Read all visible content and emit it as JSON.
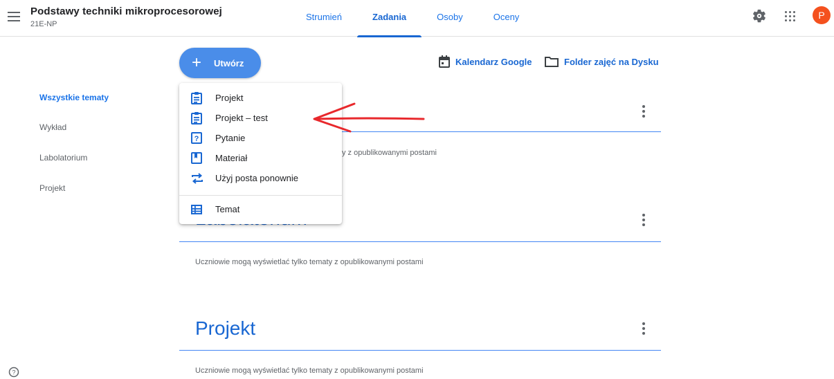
{
  "header": {
    "title": "Podstawy techniki mikroprocesorowej",
    "subtitle": "21E-NP",
    "tabs": [
      {
        "label": "Strumień"
      },
      {
        "label": "Zadania"
      },
      {
        "label": "Osoby"
      },
      {
        "label": "Oceny"
      }
    ],
    "active_tab": "Zadania",
    "avatar_letter": "P"
  },
  "create_button": {
    "label": "Utwórz"
  },
  "links": {
    "calendar": "Kalendarz Google",
    "drive": "Folder zajęć na Dysku"
  },
  "sidebar": {
    "items": [
      {
        "label": "Wszystkie tematy"
      },
      {
        "label": "Wykład"
      },
      {
        "label": "Labolatorium"
      },
      {
        "label": "Projekt"
      }
    ]
  },
  "dropdown": {
    "items": [
      {
        "label": "Projekt",
        "icon": "assignment-icon"
      },
      {
        "label": "Projekt – test",
        "icon": "assignment-icon"
      },
      {
        "label": "Pytanie",
        "icon": "question-icon"
      },
      {
        "label": "Materiał",
        "icon": "material-icon"
      },
      {
        "label": "Użyj posta ponownie",
        "icon": "reuse-icon"
      },
      {
        "label": "Temat",
        "icon": "topic-icon"
      }
    ]
  },
  "topics": [
    {
      "title": "",
      "note": "Uczniowie mogą wyświetlać tylko tematy z opublikowanymi postami"
    },
    {
      "title": "Labolatorium",
      "note": "Uczniowie mogą wyświetlać tylko tematy z opublikowanymi postami"
    },
    {
      "title": "Projekt",
      "note": "Uczniowie mogą wyświetlać tylko tematy z opublikowanymi postami"
    }
  ],
  "partial_note_visible": "y z opublikowanymi postami",
  "colors": {
    "accent": "#1967d2",
    "create_button": "#4a8de9",
    "avatar": "#f4511e",
    "annotation_arrow": "#e8282c"
  }
}
